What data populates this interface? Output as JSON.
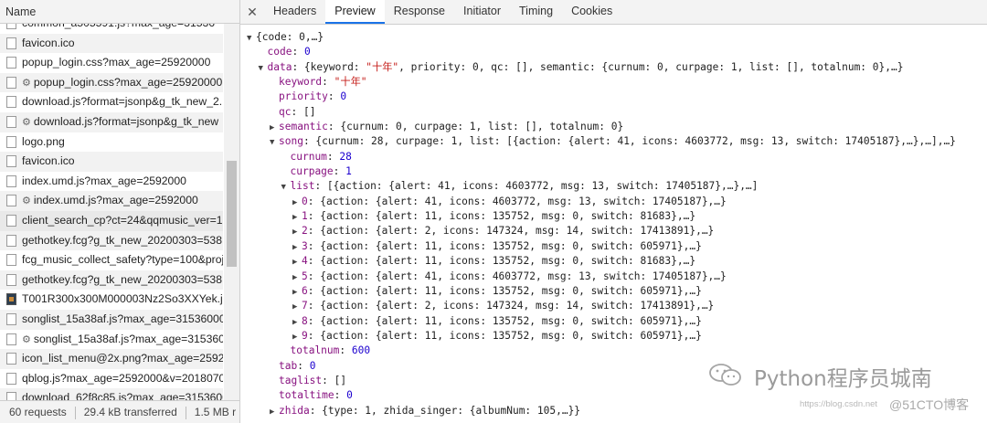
{
  "left": {
    "header": "Name",
    "rows": [
      {
        "text": "common_a505591.js?max_age=31536",
        "icon": "file",
        "gear": false
      },
      {
        "text": "favicon.ico",
        "icon": "file",
        "gear": false
      },
      {
        "text": "popup_login.css?max_age=25920000",
        "icon": "file",
        "gear": false
      },
      {
        "text": "popup_login.css?max_age=25920000",
        "icon": "file",
        "gear": true
      },
      {
        "text": "download.js?format=jsonp&g_tk_new_2.",
        "icon": "file",
        "gear": false
      },
      {
        "text": "download.js?format=jsonp&g_tk_new",
        "icon": "file",
        "gear": true
      },
      {
        "text": "logo.png",
        "icon": "file",
        "gear": false
      },
      {
        "text": "favicon.ico",
        "icon": "file",
        "gear": false
      },
      {
        "text": "index.umd.js?max_age=2592000",
        "icon": "file",
        "gear": false
      },
      {
        "text": "index.umd.js?max_age=2592000",
        "icon": "file",
        "gear": true
      },
      {
        "text": "client_search_cp?ct=24&qqmusic_ver=1.",
        "icon": "file",
        "gear": false
      },
      {
        "text": "gethotkey.fcg?g_tk_new_20200303=538.",
        "icon": "file",
        "gear": false
      },
      {
        "text": "fcg_music_collect_safety?type=100&proj",
        "icon": "file",
        "gear": false
      },
      {
        "text": "gethotkey.fcg?g_tk_new_20200303=538.",
        "icon": "file",
        "gear": false
      },
      {
        "text": "T001R300x300M000003Nz2So3XXYek.jp.",
        "icon": "img",
        "gear": false
      },
      {
        "text": "songlist_15a38af.js?max_age=31536000",
        "icon": "file",
        "gear": false
      },
      {
        "text": "songlist_15a38af.js?max_age=3153600",
        "icon": "file",
        "gear": true
      },
      {
        "text": "icon_list_menu@2x.png?max_age=25920",
        "icon": "file",
        "gear": false
      },
      {
        "text": "qblog.js?max_age=2592000&v=2018070",
        "icon": "file",
        "gear": false
      },
      {
        "text": "download_62f8c85.js?max_age=3153600",
        "icon": "file",
        "gear": false
      }
    ],
    "status": {
      "requests": "60 requests",
      "transferred": "29.4 kB transferred",
      "size": "1.5 MB r"
    }
  },
  "tabs": [
    "Headers",
    "Preview",
    "Response",
    "Initiator",
    "Timing",
    "Cookies"
  ],
  "active_tab": "Preview",
  "tree": [
    {
      "d": 0,
      "a": "down",
      "t": [
        [
          "",
          "{code: 0,…}"
        ]
      ]
    },
    {
      "d": 1,
      "a": "",
      "t": [
        [
          "k",
          "code"
        ],
        [
          "",
          ": "
        ],
        [
          "n",
          "0"
        ]
      ]
    },
    {
      "d": 1,
      "a": "down",
      "t": [
        [
          "k",
          "data"
        ],
        [
          "",
          ": {keyword: "
        ],
        [
          "s",
          "\"十年\""
        ],
        [
          "",
          ", priority: 0, qc: [], semantic: {curnum: 0, curpage: 1, list: [], totalnum: 0},…}"
        ]
      ]
    },
    {
      "d": 2,
      "a": "",
      "t": [
        [
          "k",
          "keyword"
        ],
        [
          "",
          ": "
        ],
        [
          "s",
          "\"十年\""
        ]
      ]
    },
    {
      "d": 2,
      "a": "",
      "t": [
        [
          "k",
          "priority"
        ],
        [
          "",
          ": "
        ],
        [
          "n",
          "0"
        ]
      ]
    },
    {
      "d": 2,
      "a": "",
      "t": [
        [
          "k",
          "qc"
        ],
        [
          "",
          ": []"
        ]
      ]
    },
    {
      "d": 2,
      "a": "right",
      "t": [
        [
          "k",
          "semantic"
        ],
        [
          "",
          ": {curnum: 0, curpage: 1, list: [], totalnum: 0}"
        ]
      ]
    },
    {
      "d": 2,
      "a": "down",
      "t": [
        [
          "k",
          "song"
        ],
        [
          "",
          ": {curnum: 28, curpage: 1, list: [{action: {alert: 41, icons: 4603772, msg: 13, switch: 17405187},…},…],…}"
        ]
      ]
    },
    {
      "d": 3,
      "a": "",
      "t": [
        [
          "k",
          "curnum"
        ],
        [
          "",
          ": "
        ],
        [
          "n",
          "28"
        ]
      ]
    },
    {
      "d": 3,
      "a": "",
      "t": [
        [
          "k",
          "curpage"
        ],
        [
          "",
          ": "
        ],
        [
          "n",
          "1"
        ]
      ]
    },
    {
      "d": 3,
      "a": "down",
      "t": [
        [
          "k",
          "list"
        ],
        [
          "",
          ": [{action: {alert: 41, icons: 4603772, msg: 13, switch: 17405187},…},…]"
        ]
      ]
    },
    {
      "d": 4,
      "a": "right",
      "t": [
        [
          "k",
          "0"
        ],
        [
          "",
          ": {action: {alert: 41, icons: 4603772, msg: 13, switch: 17405187},…}"
        ]
      ]
    },
    {
      "d": 4,
      "a": "right",
      "t": [
        [
          "k",
          "1"
        ],
        [
          "",
          ": {action: {alert: 11, icons: 135752, msg: 0, switch: 81683},…}"
        ]
      ]
    },
    {
      "d": 4,
      "a": "right",
      "t": [
        [
          "k",
          "2"
        ],
        [
          "",
          ": {action: {alert: 2, icons: 147324, msg: 14, switch: 17413891},…}"
        ]
      ]
    },
    {
      "d": 4,
      "a": "right",
      "t": [
        [
          "k",
          "3"
        ],
        [
          "",
          ": {action: {alert: 11, icons: 135752, msg: 0, switch: 605971},…}"
        ]
      ]
    },
    {
      "d": 4,
      "a": "right",
      "t": [
        [
          "k",
          "4"
        ],
        [
          "",
          ": {action: {alert: 11, icons: 135752, msg: 0, switch: 81683},…}"
        ]
      ]
    },
    {
      "d": 4,
      "a": "right",
      "t": [
        [
          "k",
          "5"
        ],
        [
          "",
          ": {action: {alert: 41, icons: 4603772, msg: 13, switch: 17405187},…}"
        ]
      ]
    },
    {
      "d": 4,
      "a": "right",
      "t": [
        [
          "k",
          "6"
        ],
        [
          "",
          ": {action: {alert: 11, icons: 135752, msg: 0, switch: 605971},…}"
        ]
      ]
    },
    {
      "d": 4,
      "a": "right",
      "t": [
        [
          "k",
          "7"
        ],
        [
          "",
          ": {action: {alert: 2, icons: 147324, msg: 14, switch: 17413891},…}"
        ]
      ]
    },
    {
      "d": 4,
      "a": "right",
      "t": [
        [
          "k",
          "8"
        ],
        [
          "",
          ": {action: {alert: 11, icons: 135752, msg: 0, switch: 605971},…}"
        ]
      ]
    },
    {
      "d": 4,
      "a": "right",
      "t": [
        [
          "k",
          "9"
        ],
        [
          "",
          ": {action: {alert: 11, icons: 135752, msg: 0, switch: 605971},…}"
        ]
      ]
    },
    {
      "d": 3,
      "a": "",
      "t": [
        [
          "k",
          "totalnum"
        ],
        [
          "",
          ": "
        ],
        [
          "n",
          "600"
        ]
      ]
    },
    {
      "d": 2,
      "a": "",
      "t": [
        [
          "k",
          "tab"
        ],
        [
          "",
          ": "
        ],
        [
          "n",
          "0"
        ]
      ]
    },
    {
      "d": 2,
      "a": "",
      "t": [
        [
          "k",
          "taglist"
        ],
        [
          "",
          ": []"
        ]
      ]
    },
    {
      "d": 2,
      "a": "",
      "t": [
        [
          "k",
          "totaltime"
        ],
        [
          "",
          ": "
        ],
        [
          "n",
          "0"
        ]
      ]
    },
    {
      "d": 2,
      "a": "right",
      "t": [
        [
          "k",
          "zhida"
        ],
        [
          "",
          ": {type: 1, zhida_singer: {albumNum: 105,…}}"
        ]
      ]
    }
  ],
  "watermark": {
    "text": "Python程序员城南",
    "url": "https://blog.csdn.net",
    "cto": "@51CTO博客"
  }
}
